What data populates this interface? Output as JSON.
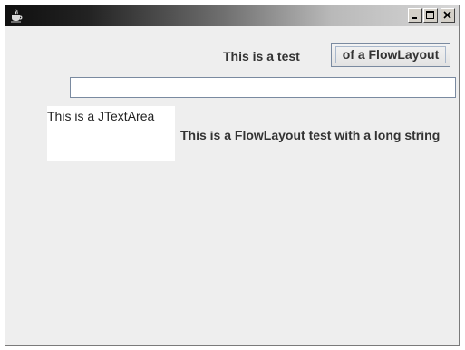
{
  "window": {
    "title": "",
    "icon": "java-cup-icon",
    "buttons": [
      "minimize-icon",
      "maximize-icon",
      "close-icon"
    ]
  },
  "row1": {
    "label": "This is a test",
    "button_label": "of a FlowLayout"
  },
  "row2": {
    "text_field_value": ""
  },
  "row3": {
    "text_area_value": "This is a JTextArea",
    "label": "This is a FlowLayout test with a long string"
  },
  "colors": {
    "content_background": "#eeeeee",
    "text": "#333333",
    "field_border": "#7a8aa0"
  }
}
